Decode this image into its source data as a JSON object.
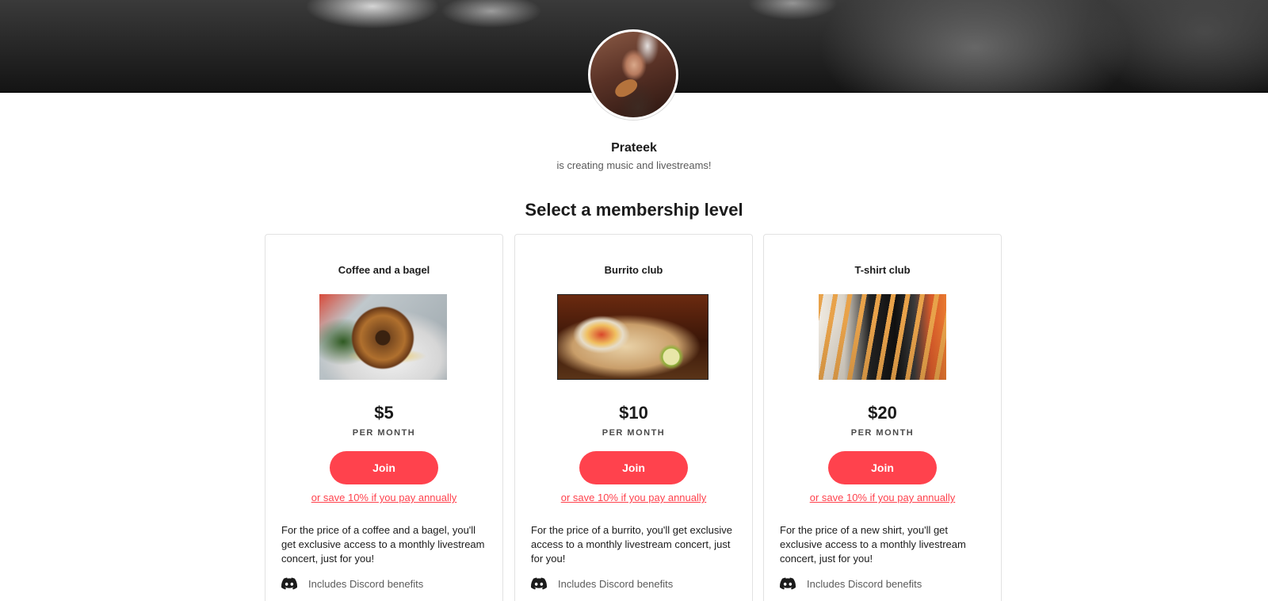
{
  "creator": {
    "name": "Prateek",
    "tagline": "is creating music and livestreams!"
  },
  "section_title": "Select a membership level",
  "colors": {
    "accent": "#ff424d",
    "text": "#1b1b1b",
    "muted": "#5a5a5a",
    "card_border": "#e2e2e2"
  },
  "tiers": [
    {
      "title": "Coffee and a bagel",
      "image_icon": "bagel-photo",
      "price": "$5",
      "period": "PER MONTH",
      "join_label": "Join",
      "annual_link": "or save 10% if you pay annually",
      "description": "For the price of a coffee and a bagel, you'll get exclusive access to a monthly livestream concert, just for you!",
      "benefit_icon": "discord-icon",
      "benefit": "Includes Discord benefits"
    },
    {
      "title": "Burrito club",
      "image_icon": "burrito-photo",
      "price": "$10",
      "period": "PER MONTH",
      "join_label": "Join",
      "annual_link": "or save 10% if you pay annually",
      "description": "For the price of a burrito, you'll get exclusive access to a monthly livestream concert, just for you!",
      "benefit_icon": "discord-icon",
      "benefit": "Includes Discord benefits"
    },
    {
      "title": "T-shirt club",
      "image_icon": "tshirts-photo",
      "price": "$20",
      "period": "PER MONTH",
      "join_label": "Join",
      "annual_link": "or save 10% if you pay annually",
      "description": "For the price of a new shirt, you'll get exclusive access to a monthly livestream concert, just for you!",
      "benefit_icon": "discord-icon",
      "benefit": "Includes Discord benefits"
    }
  ]
}
